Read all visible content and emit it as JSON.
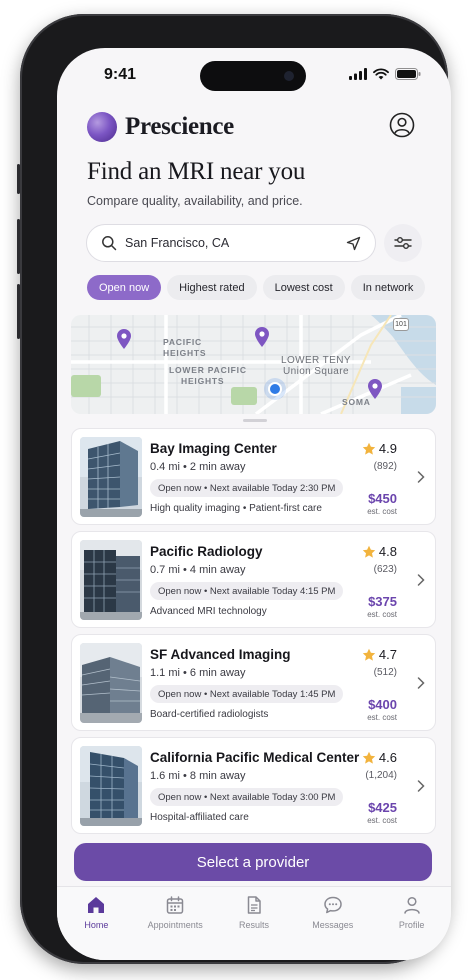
{
  "status_bar": {
    "time": "9:41"
  },
  "brand": {
    "name": "Prescience"
  },
  "header": {
    "title": "Find an MRI near you",
    "subtitle": "Compare quality, availability, and price."
  },
  "search": {
    "location": "San Francisco, CA"
  },
  "filters": [
    {
      "label": "Open now",
      "active": true
    },
    {
      "label": "Highest rated",
      "active": false
    },
    {
      "label": "Lowest cost",
      "active": false
    },
    {
      "label": "In network",
      "active": false
    }
  ],
  "map": {
    "labels": [
      "PACIFIC",
      "HEIGHTS",
      "LOWER PACIFIC",
      "HEIGHTS",
      "Union Square",
      "SOMA",
      "LOWER TENY"
    ],
    "highway": "101"
  },
  "providers": [
    {
      "name": "Bay Imaging Center",
      "distance": "0.4 mi • 2 min away",
      "availability": "Open now • Next available  Today 2:30 PM",
      "feature": "High quality imaging • Patient-first care",
      "rating": "4.9",
      "reviews": "(892)",
      "price": "$450",
      "est": "est. cost"
    },
    {
      "name": "Pacific Radiology",
      "distance": "0.7 mi • 4 min away",
      "availability": "Open now • Next available  Today 4:15 PM",
      "feature": "Advanced MRI technology",
      "rating": "4.8",
      "reviews": "(623)",
      "price": "$375",
      "est": "est. cost"
    },
    {
      "name": "SF Advanced Imaging",
      "distance": "1.1 mi • 6 min away",
      "availability": "Open now • Next available  Today 1:45 PM",
      "feature": "Board-certified radiologists",
      "rating": "4.7",
      "reviews": "(512)",
      "price": "$400",
      "est": "est. cost"
    },
    {
      "name": "California Pacific Medical Center",
      "distance": "1.6 mi • 8 min away",
      "availability": "Open now • Next available  Today 3:00 PM",
      "feature": "Hospital-affiliated care",
      "rating": "4.6",
      "reviews": "(1,204)",
      "price": "$425",
      "est": "est. cost"
    }
  ],
  "cta": {
    "label": "Select a provider"
  },
  "tabs": [
    {
      "label": "Home",
      "icon": "home-icon",
      "active": true
    },
    {
      "label": "Appointments",
      "icon": "calendar-icon",
      "active": false
    },
    {
      "label": "Results",
      "icon": "document-icon",
      "active": false
    },
    {
      "label": "Messages",
      "icon": "chat-icon",
      "active": false
    },
    {
      "label": "Profile",
      "icon": "person-icon",
      "active": false
    }
  ],
  "colors": {
    "accent": "#6b4ba7",
    "chip_active": "#8d6ac9",
    "price": "#6b45ad",
    "star": "#f2b33d",
    "map_pin": "#7e56c2",
    "location_dot": "#2f7be6"
  }
}
